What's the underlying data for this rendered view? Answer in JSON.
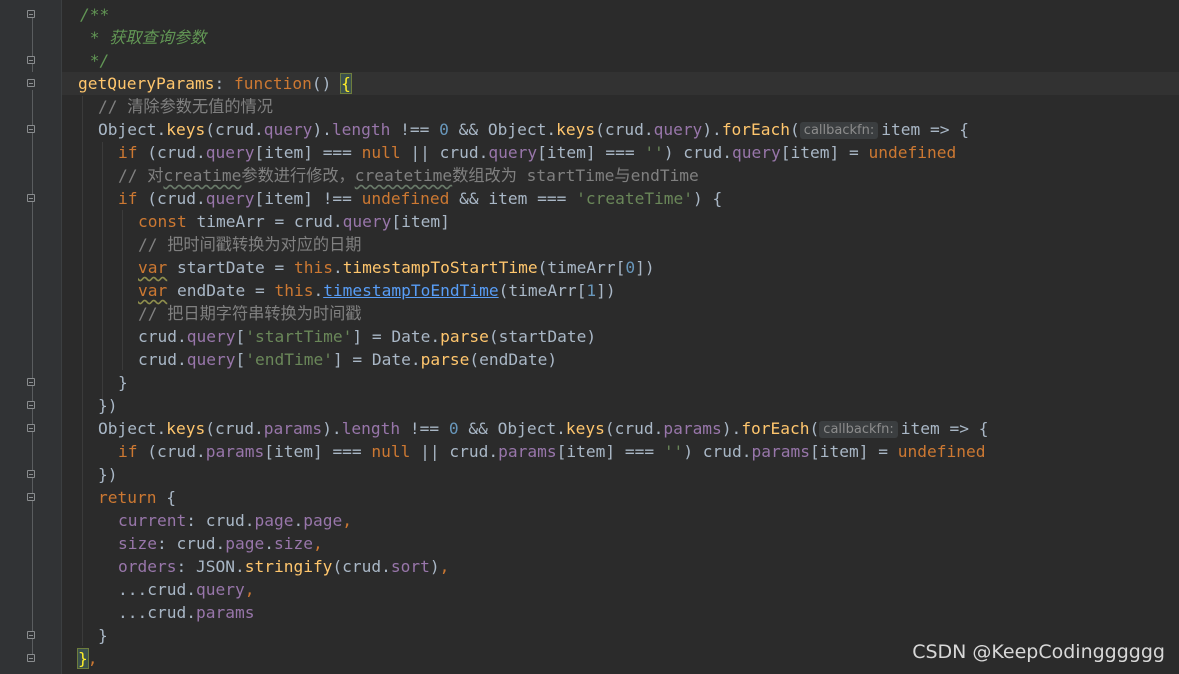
{
  "editor": {
    "watermark": "CSDN @KeepCodingggggg",
    "hints": {
      "callbackfn": "callbackfn:"
    },
    "lines": {
      "l1": "/**",
      "l2": " * 获取查询参数",
      "l3": " */",
      "l4_name": "getQueryParams",
      "l4_colon": ": ",
      "l4_fn": "function",
      "l4_paren": "() ",
      "l4_brace": "{",
      "l5": "// 清除参数无值的情况",
      "l20_close": "}",
      "l20_comma": ","
    }
  }
}
